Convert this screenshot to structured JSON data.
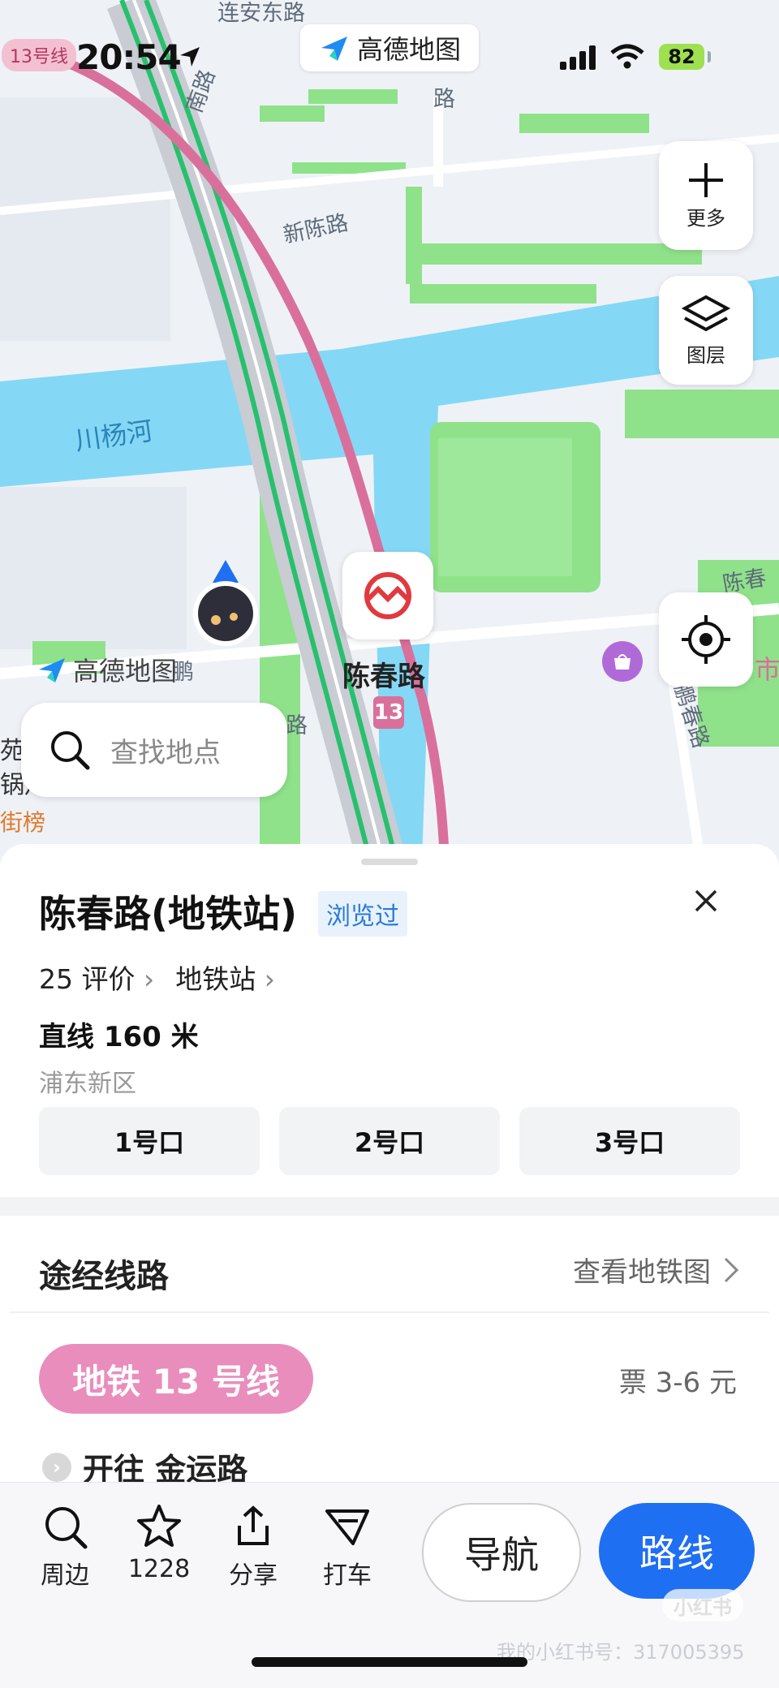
{
  "status": {
    "time": "20:54",
    "line_chip": "13号线",
    "battery": "82",
    "brand": "高德地图"
  },
  "map": {
    "labels": {
      "road_top": "连安东路",
      "road_nan": "南路",
      "road_north": "路",
      "xinchen": "新陈路",
      "chuanyang": "川杨河",
      "chenchun_right": "陈春",
      "pengchun": "鹏春路",
      "road_mid": "路",
      "peng": "鹏",
      "shi": "市",
      "left_edge_1": "苑永",
      "left_edge_2": "锅炖",
      "jiebang": "街榜"
    },
    "watermark_logo": "高德地图",
    "station_name": "陈春路",
    "station_line": "13",
    "buttons": {
      "more_label": "更多",
      "layers_label": "图层"
    },
    "search_placeholder": "查找地点"
  },
  "poi": {
    "title": "陈春路(地铁站)",
    "browsed_tag": "浏览过",
    "reviews": "25 评价",
    "category": "地铁站",
    "distance": "直线 160 米",
    "district": "浦东新区",
    "exits": [
      "1号口",
      "2号口",
      "3号口"
    ]
  },
  "routes": {
    "section_title": "途经线路",
    "metro_map_link": "查看地铁图",
    "line_name": "地铁 13 号线",
    "fare": "票 3-6 元",
    "direction": "开往 金运路"
  },
  "toolbar": {
    "nearby": "周边",
    "favorites": "1228",
    "share": "分享",
    "taxi": "打车",
    "navigate": "导航",
    "route": "路线"
  },
  "watermark": {
    "text": "我的小红书号：317005395",
    "logo": "小红书"
  },
  "colors": {
    "water": "#84d8f5",
    "green": "#8fe28a",
    "metro_line": "#d9709c",
    "accent_blue": "#1f6ff2"
  }
}
